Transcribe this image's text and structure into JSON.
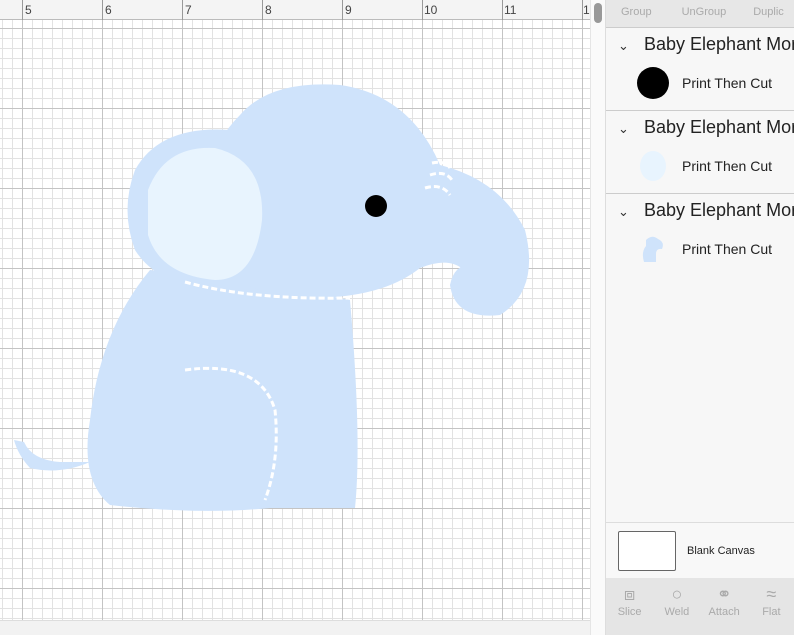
{
  "ruler": {
    "labels": [
      "5",
      "6",
      "7",
      "8",
      "9",
      "10",
      "11",
      "1"
    ]
  },
  "toolbar": {
    "items": [
      "Group",
      "UnGroup",
      "Duplic"
    ]
  },
  "layers": [
    {
      "title": "Baby Elephant Mor",
      "operation": "Print Then Cut",
      "thumb": "eye-dot"
    },
    {
      "title": "Baby Elephant Mor",
      "operation": "Print Then Cut",
      "thumb": "ear"
    },
    {
      "title": "Baby Elephant Mor",
      "operation": "Print Then Cut",
      "thumb": "elephant-body"
    }
  ],
  "blank_canvas": {
    "label": "Blank Canvas"
  },
  "bottom_tools": [
    {
      "label": "Slice",
      "icon": "slice-icon"
    },
    {
      "label": "Weld",
      "icon": "weld-icon"
    },
    {
      "label": "Attach",
      "icon": "attach-icon"
    },
    {
      "label": "Flat",
      "icon": "flatten-icon"
    }
  ],
  "colors": {
    "elephant": "#cfe3fb",
    "ear_inner": "#e8f4fe",
    "eye": "#000000"
  }
}
